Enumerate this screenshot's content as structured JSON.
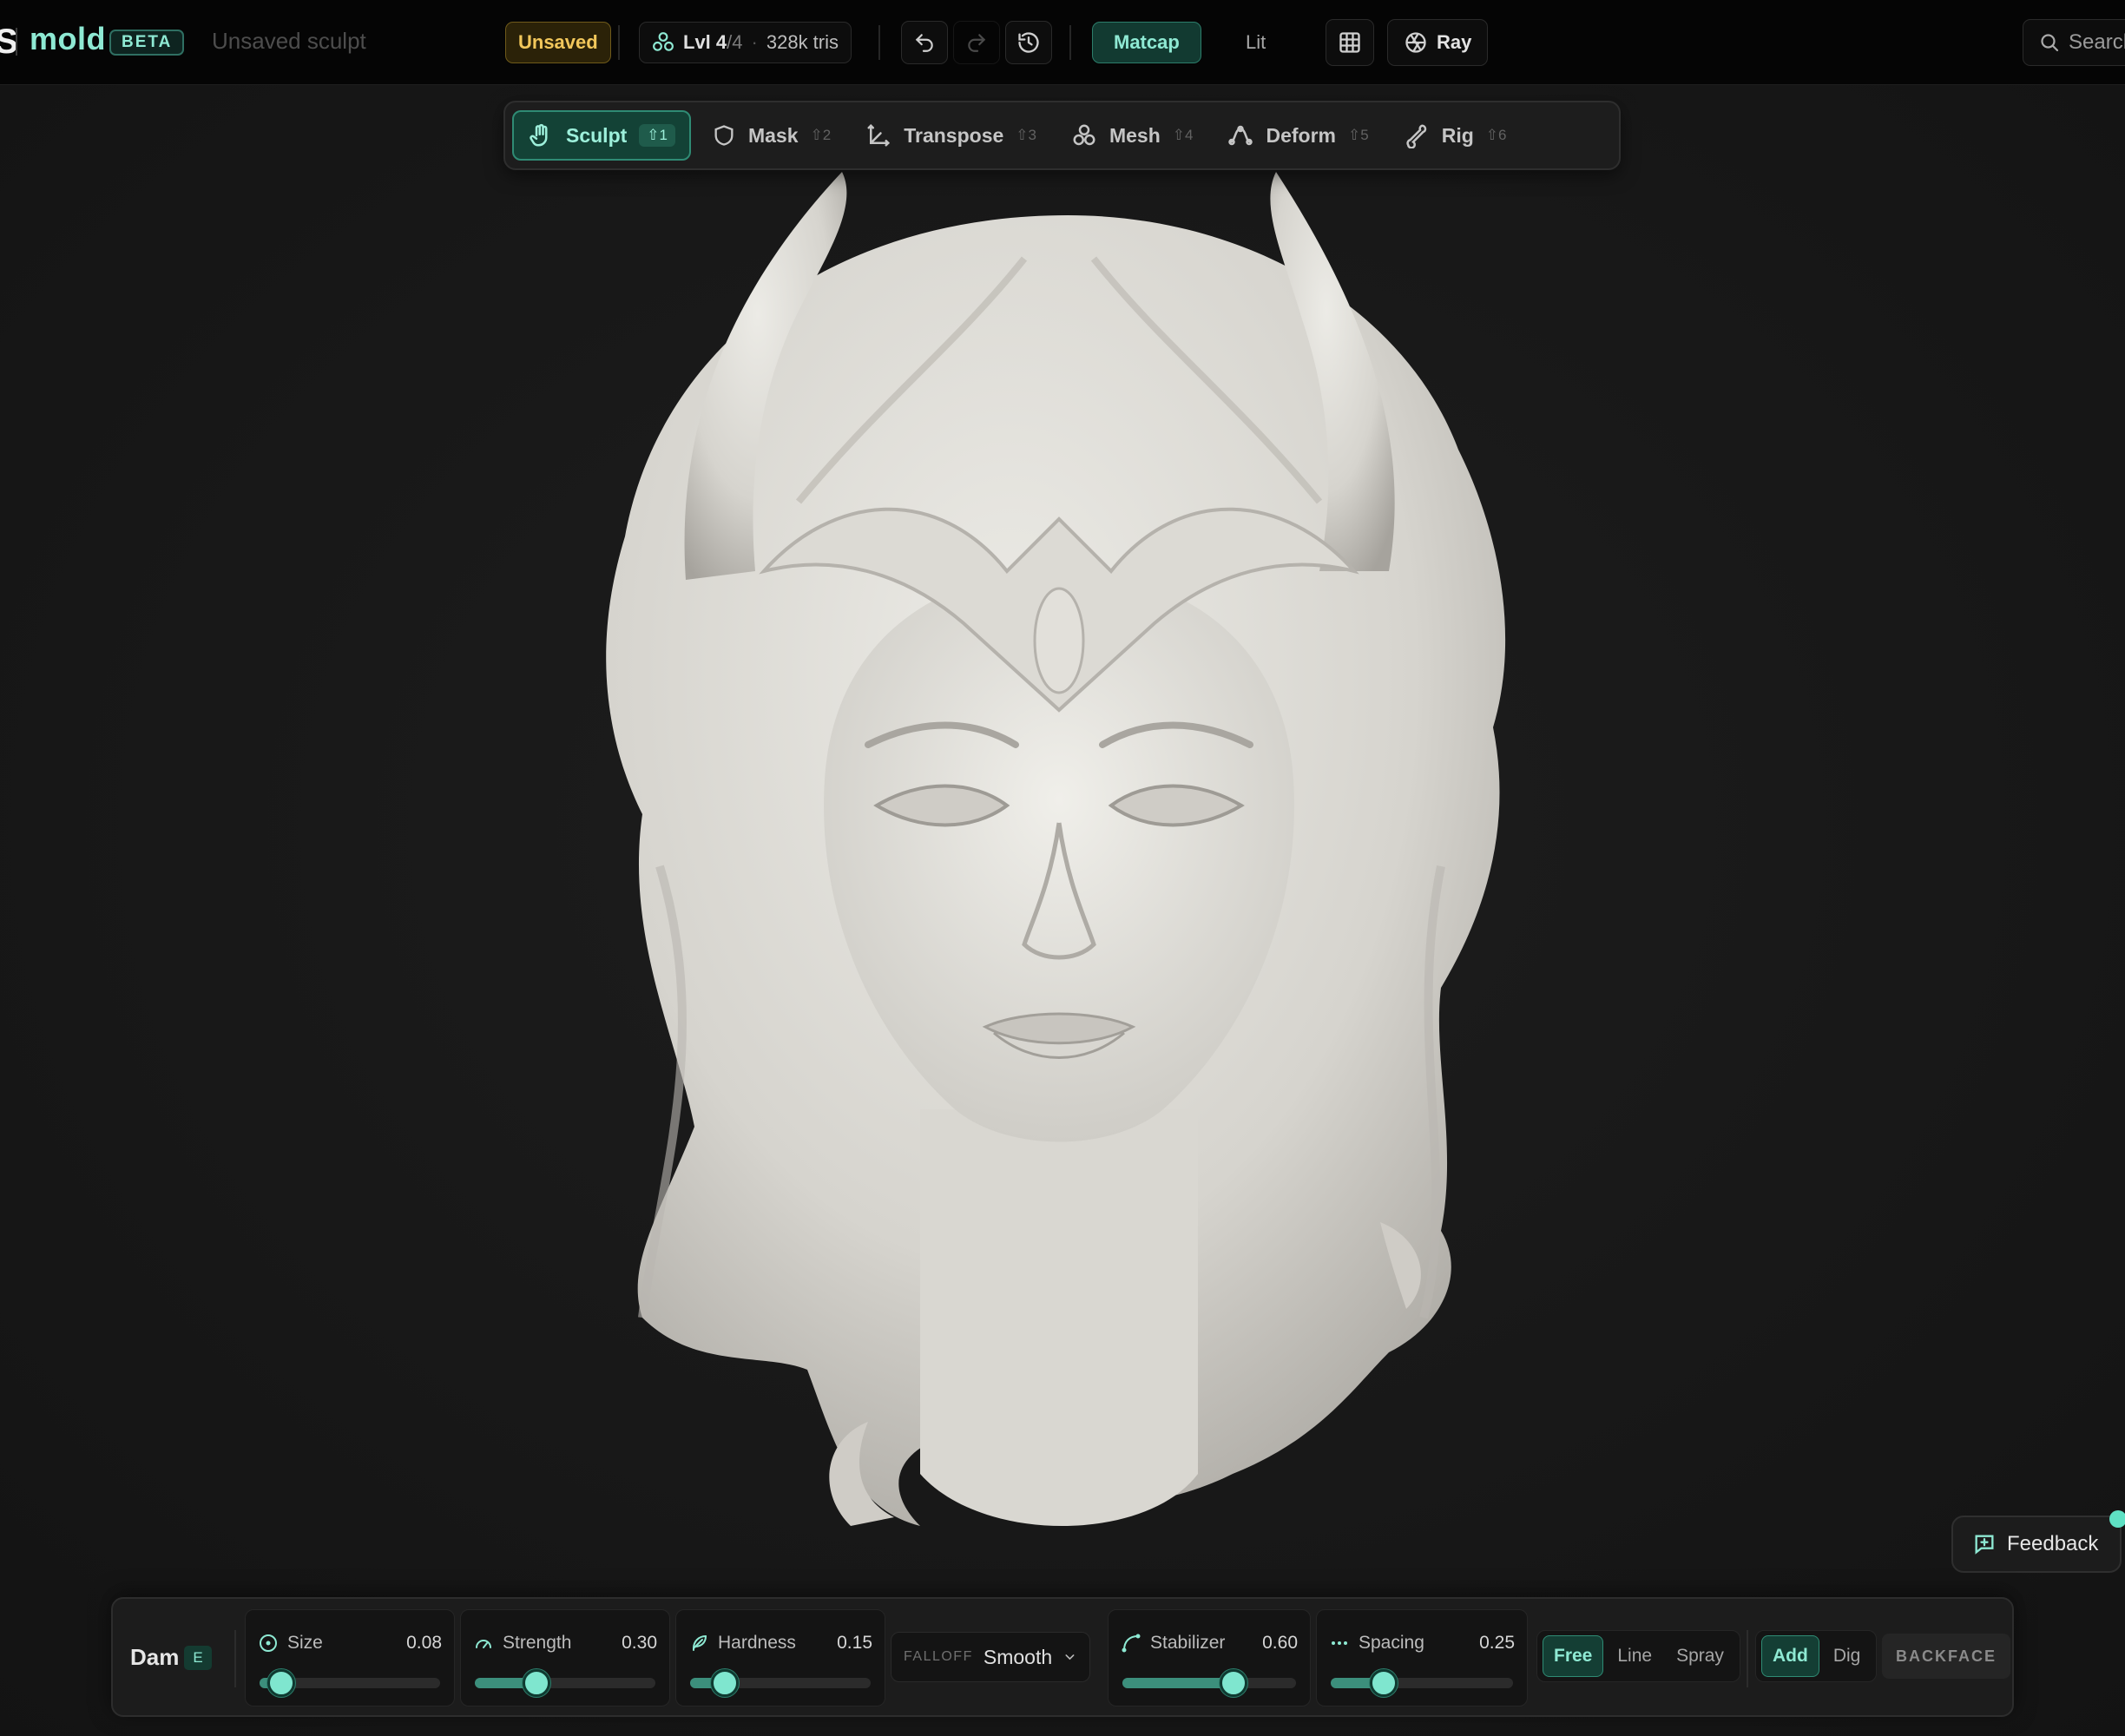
{
  "app": {
    "name": "mold",
    "badge": "BETA",
    "glyph": "S",
    "document_title": "Unsaved sculpt",
    "save_status": "Unsaved"
  },
  "toolbar": {
    "level_label": "Lvl",
    "level_current": "4",
    "level_total": "/4",
    "tris": "328k tris",
    "shading_options": [
      {
        "label": "Matcap",
        "active": true
      },
      {
        "label": "Lit",
        "active": false
      }
    ],
    "ray_label": "Ray",
    "search_placeholder": "Search"
  },
  "modes": [
    {
      "label": "Sculpt",
      "key": "⇧1",
      "icon": "hand-icon",
      "active": true
    },
    {
      "label": "Mask",
      "key": "⇧2",
      "icon": "shield-icon",
      "active": false
    },
    {
      "label": "Transpose",
      "key": "⇧3",
      "icon": "transpose-icon",
      "active": false
    },
    {
      "label": "Mesh",
      "key": "⇧4",
      "icon": "mesh-icon",
      "active": false
    },
    {
      "label": "Deform",
      "key": "⇧5",
      "icon": "deform-icon",
      "active": false
    },
    {
      "label": "Rig",
      "key": "⇧6",
      "icon": "bone-icon",
      "active": false
    }
  ],
  "brush": {
    "name": "Dam",
    "key": "E",
    "sliders": [
      {
        "label": "Size",
        "value": "0.08",
        "fraction": 0.08,
        "icon": "circle-icon"
      },
      {
        "label": "Strength",
        "value": "0.30",
        "fraction": 0.3,
        "icon": "gauge-icon"
      },
      {
        "label": "Hardness",
        "value": "0.15",
        "fraction": 0.15,
        "icon": "feather-icon"
      },
      {
        "label": "Stabilizer",
        "value": "0.60",
        "fraction": 0.6,
        "icon": "curve-icon"
      },
      {
        "label": "Spacing",
        "value": "0.25",
        "fraction": 0.25,
        "icon": "dots-icon"
      }
    ],
    "falloff_label": "FALLOFF",
    "falloff_value": "Smooth",
    "stroke_modes": [
      {
        "label": "Free",
        "active": true
      },
      {
        "label": "Line",
        "active": false
      },
      {
        "label": "Spray",
        "active": false
      }
    ],
    "direction_modes": [
      {
        "label": "Add",
        "active": true
      },
      {
        "label": "Dig",
        "active": false
      }
    ],
    "backface_label": "BACKFACE"
  },
  "feedback_label": "Feedback",
  "colors": {
    "accent": "#8ee9d3",
    "accent_bg": "#134236",
    "warning": "#f2c75b",
    "background": "#161616"
  }
}
